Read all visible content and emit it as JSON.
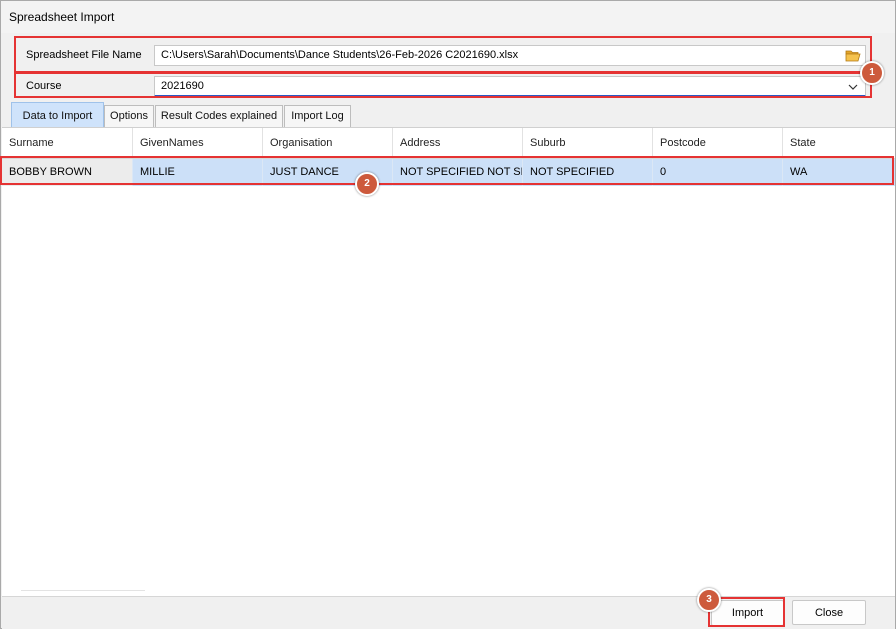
{
  "window": {
    "title": "Spreadsheet Import"
  },
  "form": {
    "file_label": "Spreadsheet File Name",
    "file_value": "C:\\Users\\Sarah\\Documents\\Dance Students\\26-Feb-2026 C2021690.xlsx",
    "course_label": "Course",
    "course_value": "2021690"
  },
  "tabs": [
    {
      "label": "Data to Import",
      "active": true
    },
    {
      "label": "Options",
      "active": false
    },
    {
      "label": "Result Codes explained",
      "active": false
    },
    {
      "label": "Import Log",
      "active": false
    }
  ],
  "grid": {
    "columns": [
      "Surname",
      "GivenNames",
      "Organisation",
      "Address",
      "Suburb",
      "Postcode",
      "State"
    ],
    "rows": [
      [
        "BOBBY BROWN",
        "MILLIE",
        "JUST DANCE",
        "NOT SPECIFIED NOT SPE",
        "NOT SPECIFIED",
        "0",
        "WA"
      ]
    ]
  },
  "buttons": {
    "import": "Import",
    "close": "Close"
  },
  "callouts": [
    "1",
    "2",
    "3"
  ],
  "icons": {
    "browse": "folder-open-icon",
    "dropdown": "chevron-down-icon"
  },
  "colors": {
    "highlight": "#e53333",
    "badge": "#cd5a3c",
    "selection": "#cce0f8",
    "active_tab": "#cfe3fb"
  }
}
